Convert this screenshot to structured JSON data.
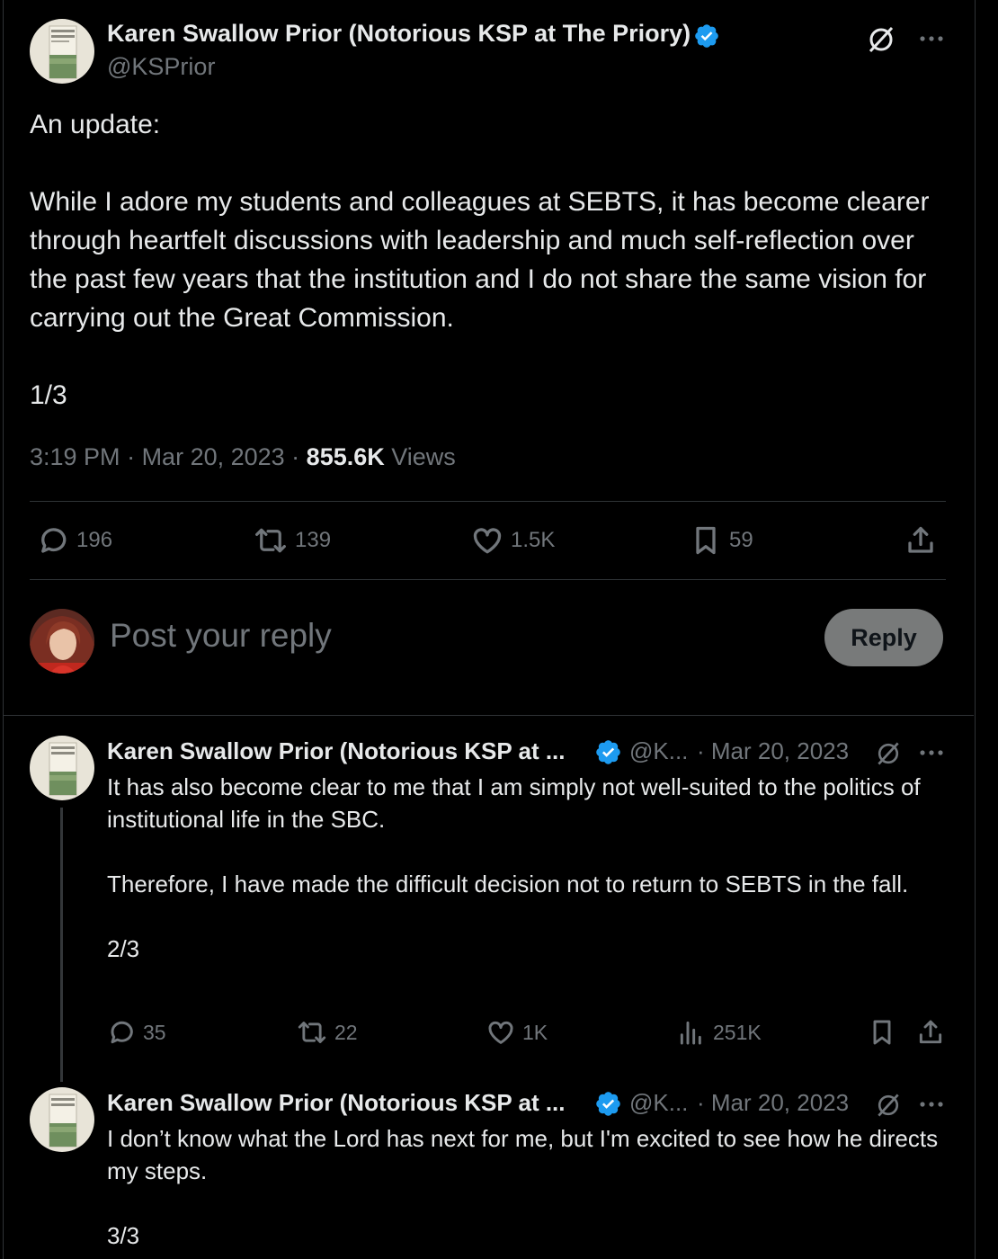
{
  "colors": {
    "background": "#000000",
    "text": "#e7e9ea",
    "muted": "#71767b",
    "verified": "#1d9bf0",
    "divider": "#2f3336",
    "reply_button": "#787a7a"
  },
  "main_post": {
    "author_name": "Karen Swallow Prior (Notorious KSP at The Priory)",
    "handle": "@KSPrior",
    "text": "An update:\n\nWhile I adore my students and colleagues at SEBTS, it has become clearer through heartfelt discussions with leadership and much self-reflection over the past few years that the institution and I do not share the same vision for carrying out the Great Commission.\n\n1/3",
    "time": "3:19 PM",
    "date": "Mar 20, 2023",
    "views_count": "855.6K",
    "views_label": "Views",
    "replies": "196",
    "reposts": "139",
    "likes": "1.5K",
    "bookmarks": "59"
  },
  "reply_box": {
    "placeholder": "Post your reply",
    "button_label": "Reply"
  },
  "thread": [
    {
      "author_name": "Karen Swallow Prior (Notorious KSP at ...",
      "handle": "@K...",
      "date": "· Mar 20, 2023",
      "text": "It has also become clear to me that I am simply not well-suited to the politics of institutional life in the SBC.\n\nTherefore, I have made the difficult decision not to return to SEBTS in the fall.\n\n2/3",
      "replies": "35",
      "reposts": "22",
      "likes": "1K",
      "views": "251K"
    },
    {
      "author_name": "Karen Swallow Prior (Notorious KSP at ...",
      "handle": "@K...",
      "date": "· Mar 20, 2023",
      "text": "I don’t know what the Lord has next for me, but I'm excited to see how he directs my steps.\n\n3/3"
    }
  ]
}
